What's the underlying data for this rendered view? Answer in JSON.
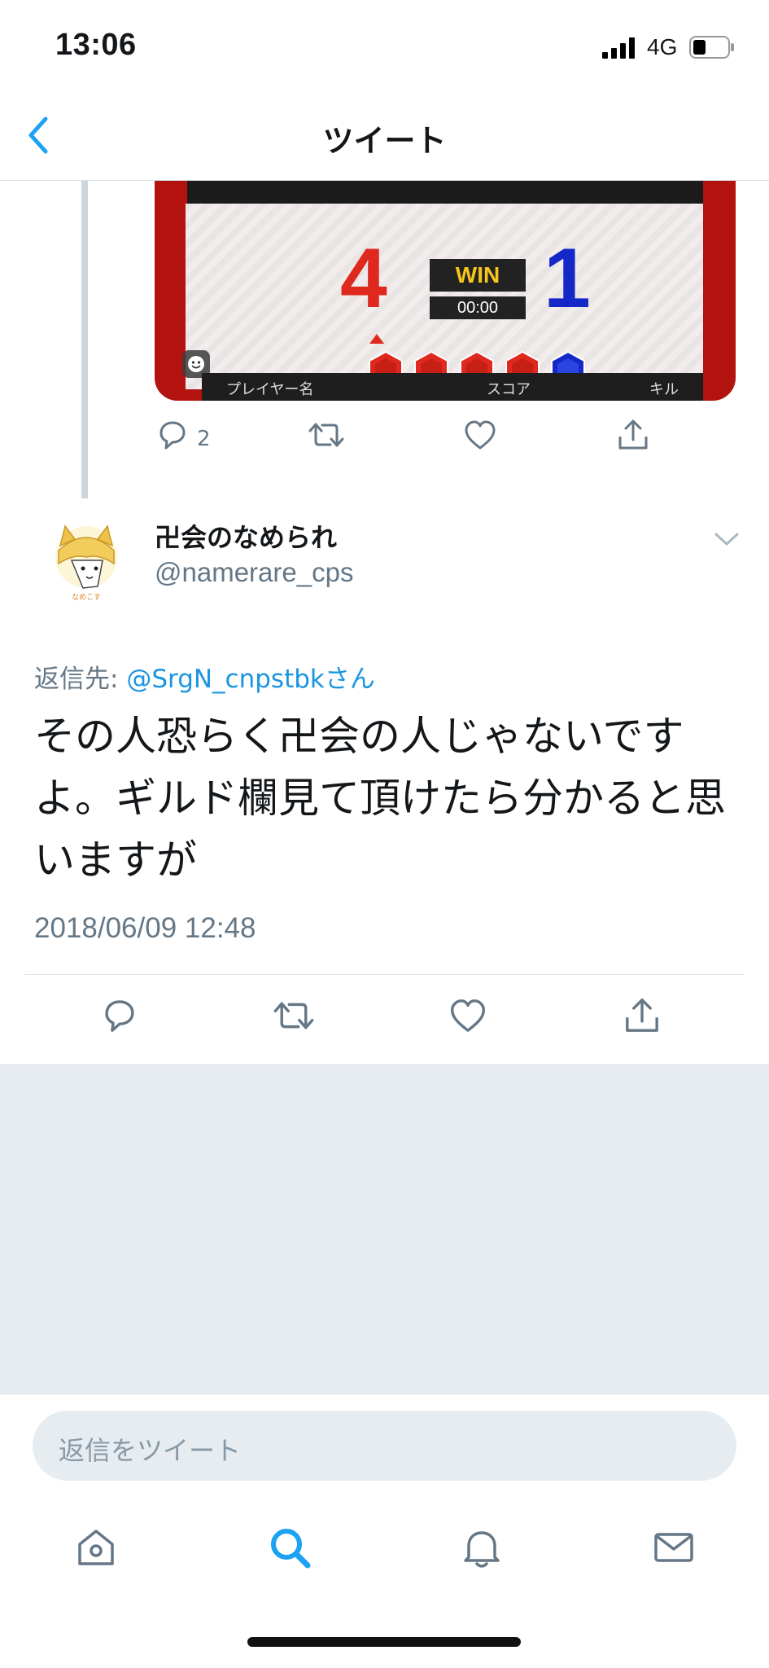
{
  "status": {
    "time": "13:06",
    "network": "4G"
  },
  "nav": {
    "title": "ツイート"
  },
  "parent_tweet": {
    "media": {
      "score_left": "4",
      "score_right": "1",
      "win_label": "WIN",
      "time_label": "00:00",
      "footer_player": "プレイヤー名",
      "footer_score": "スコア",
      "footer_kill": "キル"
    },
    "reply_count": "2"
  },
  "tweet": {
    "author_name": "卍会のなめられ",
    "author_handle": "@namerare_cps",
    "reply_prefix": "返信先: ",
    "reply_mention": "@SrgN_cnpstbkさん",
    "text": "その人恐らく卍会の人じゃないですよ。ギルド欄見て頂けたら分かると思いますが",
    "timestamp": "2018/06/09 12:48"
  },
  "compose": {
    "placeholder": "返信をツイート"
  },
  "colors": {
    "accent": "#1da1f2",
    "secondary_text": "#657786",
    "background_gray": "#e6ecf0"
  },
  "icons": {
    "back": "chevron-left-icon",
    "reply": "reply-icon",
    "retweet": "retweet-icon",
    "like": "heart-icon",
    "share": "share-icon",
    "home": "home-icon",
    "search": "search-icon",
    "notifications": "bell-icon",
    "messages": "mail-icon"
  }
}
